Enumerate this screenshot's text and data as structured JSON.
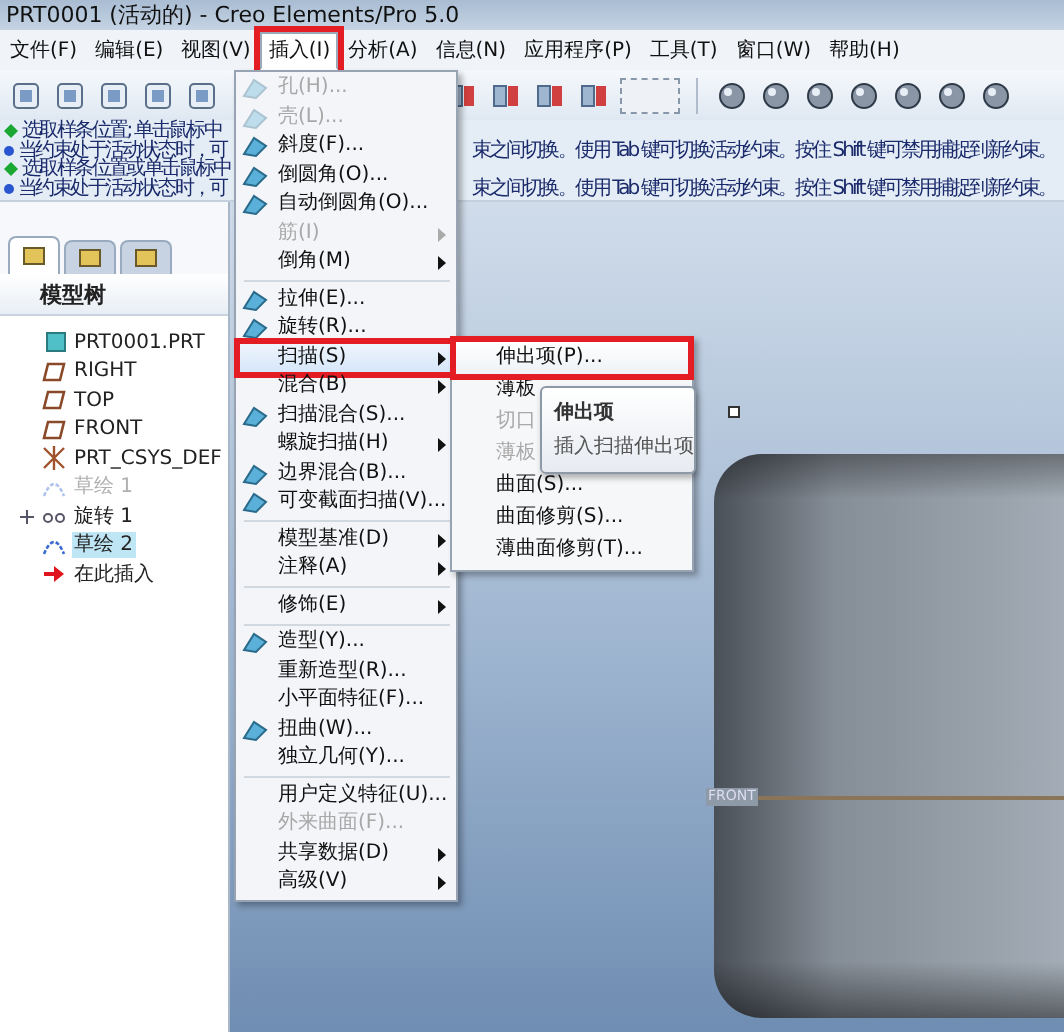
{
  "window": {
    "title": "PRT0001 (活动的) - Creo Elements/Pro 5.0"
  },
  "menu_bar": [
    {
      "label": "文件(F)",
      "selected": false,
      "marked": false
    },
    {
      "label": "编辑(E)",
      "selected": false,
      "marked": false
    },
    {
      "label": "视图(V)",
      "selected": false,
      "marked": false
    },
    {
      "label": "插入(I)",
      "selected": true,
      "marked": true
    },
    {
      "label": "分析(A)",
      "selected": false,
      "marked": false
    },
    {
      "label": "信息(N)",
      "selected": false,
      "marked": false
    },
    {
      "label": "应用程序(P)",
      "selected": false,
      "marked": false
    },
    {
      "label": "工具(T)",
      "selected": false,
      "marked": false
    },
    {
      "label": "窗口(W)",
      "selected": false,
      "marked": false
    },
    {
      "label": "帮助(H)",
      "selected": false,
      "marked": false
    }
  ],
  "messages": [
    {
      "kind": "prompt",
      "text": "选取样条位置; 单击鼠标中"
    },
    {
      "kind": "info",
      "text": "当约束处于活动状态时，可",
      "text_right": "束之间切换。使用 Tab 键可切换活动约束。按住 Shift 键可禁用捕捉到新约束。"
    },
    {
      "kind": "prompt",
      "text": "选取样条位置或单击鼠标中"
    },
    {
      "kind": "info",
      "text": "当约束处于活动状态时，可",
      "text_right": "束之间切换。使用 Tab 键可切换活动约束。按住 Shift 键可禁用捕捉到新约束。"
    }
  ],
  "model_tree": {
    "tabs": [
      {
        "selected": true
      },
      {
        "selected": false
      },
      {
        "selected": false
      }
    ],
    "title": "模型树",
    "items": [
      {
        "label": "PRT0001.PRT",
        "kind": "part",
        "selected": false,
        "disabled": false,
        "collapsed": false,
        "children": [
          {
            "label": "RIGHT",
            "kind": "plane",
            "selected": false,
            "disabled": false,
            "collapsed": false
          },
          {
            "label": "TOP",
            "kind": "plane",
            "selected": false,
            "disabled": false,
            "collapsed": false
          },
          {
            "label": "FRONT",
            "kind": "plane",
            "selected": false,
            "disabled": false,
            "collapsed": false
          },
          {
            "label": "PRT_CSYS_DEF",
            "kind": "csys",
            "selected": false,
            "disabled": false,
            "collapsed": false
          },
          {
            "label": "草绘 1",
            "kind": "sketch",
            "selected": false,
            "disabled": true,
            "collapsed": false
          },
          {
            "label": "旋转 1",
            "kind": "revolve",
            "selected": false,
            "disabled": false,
            "collapsed": true
          },
          {
            "label": "草绘 2",
            "kind": "sketch",
            "selected": true,
            "disabled": false,
            "collapsed": false
          },
          {
            "label": "在此插入",
            "kind": "insert",
            "selected": false,
            "disabled": false,
            "collapsed": false
          }
        ]
      }
    ]
  },
  "insert_menu": [
    {
      "kind": "item",
      "label": "孔(H)...",
      "icon": true,
      "disabled": true,
      "submenu": false,
      "selected": false,
      "marked": false
    },
    {
      "kind": "item",
      "label": "壳(L)...",
      "icon": true,
      "disabled": true,
      "submenu": false,
      "selected": false,
      "marked": false
    },
    {
      "kind": "item",
      "label": "斜度(F)...",
      "icon": true,
      "disabled": false,
      "submenu": false,
      "selected": false,
      "marked": false
    },
    {
      "kind": "item",
      "label": "倒圆角(O)...",
      "icon": true,
      "disabled": false,
      "submenu": false,
      "selected": false,
      "marked": false
    },
    {
      "kind": "item",
      "label": "自动倒圆角(O)...",
      "icon": true,
      "disabled": false,
      "submenu": false,
      "selected": false,
      "marked": false
    },
    {
      "kind": "item",
      "label": "筋(I)",
      "icon": false,
      "disabled": true,
      "submenu": true,
      "selected": false,
      "marked": false
    },
    {
      "kind": "item",
      "label": "倒角(M)",
      "icon": false,
      "disabled": false,
      "submenu": true,
      "selected": false,
      "marked": false
    },
    {
      "kind": "separator"
    },
    {
      "kind": "item",
      "label": "拉伸(E)...",
      "icon": true,
      "disabled": false,
      "submenu": false,
      "selected": false,
      "marked": false
    },
    {
      "kind": "item",
      "label": "旋转(R)...",
      "icon": true,
      "disabled": false,
      "submenu": false,
      "selected": false,
      "marked": false
    },
    {
      "kind": "item",
      "label": "扫描(S)",
      "icon": false,
      "disabled": false,
      "submenu": true,
      "selected": true,
      "marked": true
    },
    {
      "kind": "item",
      "label": "混合(B)",
      "icon": false,
      "disabled": false,
      "submenu": true,
      "selected": false,
      "marked": false
    },
    {
      "kind": "item",
      "label": "扫描混合(S)...",
      "icon": true,
      "disabled": false,
      "submenu": false,
      "selected": false,
      "marked": false
    },
    {
      "kind": "item",
      "label": "螺旋扫描(H)",
      "icon": false,
      "disabled": false,
      "submenu": true,
      "selected": false,
      "marked": false
    },
    {
      "kind": "item",
      "label": "边界混合(B)...",
      "icon": true,
      "disabled": false,
      "submenu": false,
      "selected": false,
      "marked": false
    },
    {
      "kind": "item",
      "label": "可变截面扫描(V)...",
      "icon": true,
      "disabled": false,
      "submenu": false,
      "selected": false,
      "marked": false
    },
    {
      "kind": "separator"
    },
    {
      "kind": "item",
      "label": "模型基准(D)",
      "icon": false,
      "disabled": false,
      "submenu": true,
      "selected": false,
      "marked": false
    },
    {
      "kind": "item",
      "label": "注释(A)",
      "icon": false,
      "disabled": false,
      "submenu": true,
      "selected": false,
      "marked": false
    },
    {
      "kind": "separator"
    },
    {
      "kind": "item",
      "label": "修饰(E)",
      "icon": false,
      "disabled": false,
      "submenu": true,
      "selected": false,
      "marked": false
    },
    {
      "kind": "separator"
    },
    {
      "kind": "item",
      "label": "造型(Y)...",
      "icon": true,
      "disabled": false,
      "submenu": false,
      "selected": false,
      "marked": false
    },
    {
      "kind": "item",
      "label": "重新造型(R)...",
      "icon": false,
      "disabled": false,
      "submenu": false,
      "selected": false,
      "marked": false
    },
    {
      "kind": "item",
      "label": "小平面特征(F)...",
      "icon": false,
      "disabled": false,
      "submenu": false,
      "selected": false,
      "marked": false
    },
    {
      "kind": "item",
      "label": "扭曲(W)...",
      "icon": true,
      "disabled": false,
      "submenu": false,
      "selected": false,
      "marked": false
    },
    {
      "kind": "item",
      "label": "独立几何(Y)...",
      "icon": false,
      "disabled": false,
      "submenu": false,
      "selected": false,
      "marked": false
    },
    {
      "kind": "separator"
    },
    {
      "kind": "item",
      "label": "用户定义特征(U)...",
      "icon": false,
      "disabled": false,
      "submenu": false,
      "selected": false,
      "marked": false
    },
    {
      "kind": "item",
      "label": "外来曲面(F)...",
      "icon": false,
      "disabled": true,
      "submenu": false,
      "selected": false,
      "marked": false
    },
    {
      "kind": "item",
      "label": "共享数据(D)",
      "icon": false,
      "disabled": false,
      "submenu": true,
      "selected": false,
      "marked": false
    },
    {
      "kind": "item",
      "label": "高级(V)",
      "icon": false,
      "disabled": false,
      "submenu": true,
      "selected": false,
      "marked": false
    }
  ],
  "sweep_submenu": [
    {
      "label": "伸出项(P)...",
      "disabled": false,
      "selected": true,
      "marked": true
    },
    {
      "label": "薄板",
      "disabled": false,
      "selected": false,
      "marked": false
    },
    {
      "label": "切口",
      "disabled": true,
      "selected": false,
      "marked": false
    },
    {
      "label": "薄板",
      "disabled": true,
      "selected": false,
      "marked": false
    },
    {
      "label": "曲面(S)...",
      "disabled": false,
      "selected": false,
      "marked": false
    },
    {
      "label": "曲面修剪(S)...",
      "disabled": false,
      "selected": false,
      "marked": false
    },
    {
      "label": "薄曲面修剪(T)...",
      "disabled": false,
      "selected": false,
      "marked": false
    }
  ],
  "tooltip": {
    "title": "伸出项",
    "text": "插入扫描伸出项"
  },
  "viewport": {
    "datum_label": "FRONT"
  }
}
